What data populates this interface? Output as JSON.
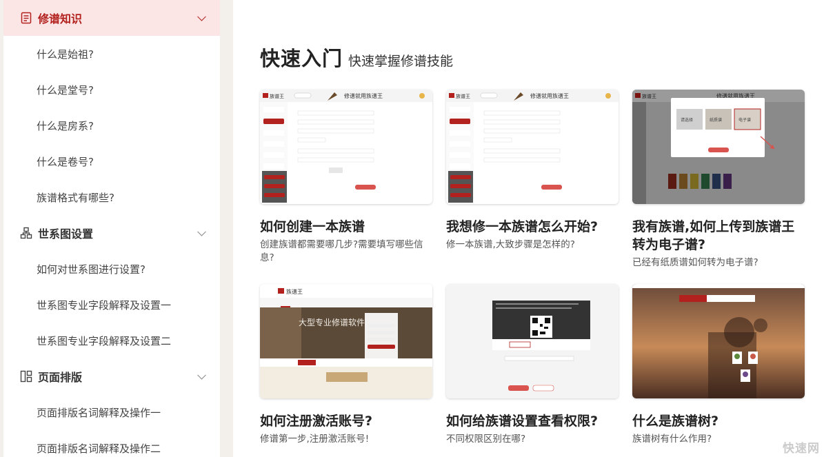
{
  "sidebar": {
    "categories": [
      {
        "label": "修谱知识",
        "icon": "document-icon",
        "active": true,
        "items": [
          "什么是始祖?",
          "什么是堂号?",
          "什么是房系?",
          "什么是卷号?",
          "族谱格式有哪些?"
        ]
      },
      {
        "label": "世系图设置",
        "icon": "org-chart-icon",
        "active": false,
        "items": [
          "如何对世系图进行设置?",
          "世系图专业字段解释及设置一",
          "世系图专业字段解释及设置二"
        ]
      },
      {
        "label": "页面排版",
        "icon": "layout-icon",
        "active": false,
        "items": [
          "页面排版名词解释及操作一",
          "页面排版名词解释及操作二"
        ]
      }
    ]
  },
  "main": {
    "title": "快速入门",
    "subtitle": "快速掌握修谱技能",
    "cards": [
      {
        "title": "如何创建一本族谱",
        "desc": "创建族谱都需要哪几步?需要填写哪些信息?"
      },
      {
        "title": "我想修一本族谱怎么开始?",
        "desc": "修一本族谱,大致步骤是怎样的?"
      },
      {
        "title": "我有族谱,如何上传到族谱王转为电子谱?",
        "desc": "已经有纸质谱如何转为电子谱?"
      },
      {
        "title": "如何注册激活账号?",
        "desc": "修谱第一步,注册激活账号!"
      },
      {
        "title": "如何给族谱设置查看权限?",
        "desc": "不同权限区别在哪?"
      },
      {
        "title": "什么是族谱树?",
        "desc": "族谱树有什么作用?"
      }
    ]
  },
  "thumbs": {
    "brand": "族谱王",
    "calligraphy": "修谱就用族谱王",
    "banner": "大型专业修谱软件",
    "dialog_options": [
      "请选择",
      "纸质谱",
      "电子谱"
    ]
  },
  "watermark": "快速网",
  "colors": {
    "accent": "#b3211e",
    "active_bg": "#fbe6e5",
    "sidebar_bg": "#f3efeb"
  }
}
